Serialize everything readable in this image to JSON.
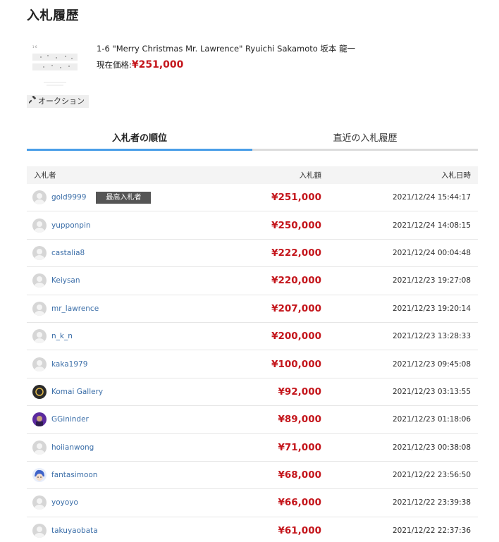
{
  "page": {
    "title": "入札履歴"
  },
  "item": {
    "title": "1-6 \"Merry Christmas Mr. Lawrence\" Ryuichi Sakamoto 坂本 龍一",
    "price_label": "現在価格:",
    "price": "¥251,000",
    "auction_label": "オークション",
    "auction_icon": "hammer-icon"
  },
  "tabs": [
    {
      "label": "入札者の順位",
      "active": true
    },
    {
      "label": "直近の入札履歴",
      "active": false
    }
  ],
  "table": {
    "headers": {
      "bidder": "入札者",
      "amount": "入札額",
      "datetime": "入札日時"
    },
    "top_badge": "最高入札者",
    "rows": [
      {
        "name": "gold9999",
        "amount": "¥251,000",
        "datetime": "2021/12/24 15:44:17",
        "avatar": "default"
      },
      {
        "name": "yupponpin",
        "amount": "¥250,000",
        "datetime": "2021/12/24 14:08:15",
        "avatar": "default"
      },
      {
        "name": "castalia8",
        "amount": "¥222,000",
        "datetime": "2021/12/24 00:04:48",
        "avatar": "default"
      },
      {
        "name": "Keiysan",
        "amount": "¥220,000",
        "datetime": "2021/12/23 19:27:08",
        "avatar": "default"
      },
      {
        "name": "mr_lawrence",
        "amount": "¥207,000",
        "datetime": "2021/12/23 19:20:14",
        "avatar": "default"
      },
      {
        "name": "n_k_n",
        "amount": "¥200,000",
        "datetime": "2021/12/23 13:28:33",
        "avatar": "default"
      },
      {
        "name": "kaka1979",
        "amount": "¥100,000",
        "datetime": "2021/12/23 09:45:08",
        "avatar": "default"
      },
      {
        "name": "Komai Gallery",
        "amount": "¥92,000",
        "datetime": "2021/12/23 03:13:55",
        "avatar": "gallery"
      },
      {
        "name": "GGininder",
        "amount": "¥89,000",
        "datetime": "2021/12/23 01:18:06",
        "avatar": "purple"
      },
      {
        "name": "hoiianwong",
        "amount": "¥71,000",
        "datetime": "2021/12/23 00:38:08",
        "avatar": "default"
      },
      {
        "name": "fantasimoon",
        "amount": "¥68,000",
        "datetime": "2021/12/22 23:56:50",
        "avatar": "character"
      },
      {
        "name": "yoyoyo",
        "amount": "¥66,000",
        "datetime": "2021/12/22 23:39:38",
        "avatar": "default"
      },
      {
        "name": "takuyaobata",
        "amount": "¥61,000",
        "datetime": "2021/12/22 22:37:36",
        "avatar": "default"
      }
    ]
  },
  "colors": {
    "price": "#c4161c",
    "link": "#3b6ea8",
    "tab_active": "#4a9ee8",
    "badge": "#555555"
  }
}
